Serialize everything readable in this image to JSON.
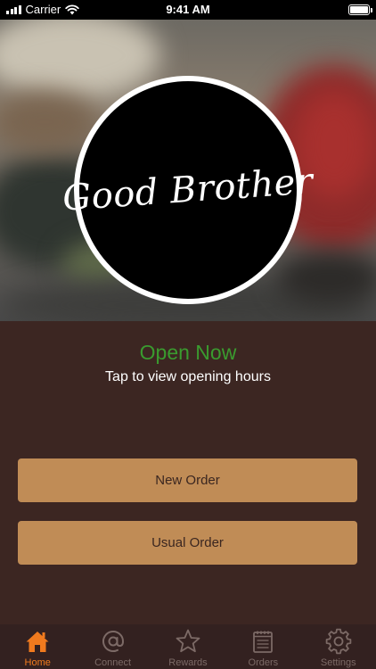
{
  "status_bar": {
    "carrier": "Carrier",
    "time": "9:41 AM"
  },
  "hero": {
    "logo_text": "Good Brother"
  },
  "status": {
    "open_text": "Open Now",
    "hours_hint": "Tap to view opening hours"
  },
  "actions": {
    "new_order": "New Order",
    "usual_order": "Usual Order"
  },
  "tabs": [
    {
      "label": "Home",
      "icon": "home-icon",
      "active": true
    },
    {
      "label": "Connect",
      "icon": "at-icon",
      "active": false
    },
    {
      "label": "Rewards",
      "icon": "star-icon",
      "active": false
    },
    {
      "label": "Orders",
      "icon": "notepad-icon",
      "active": false
    },
    {
      "label": "Settings",
      "icon": "gear-icon",
      "active": false
    }
  ],
  "colors": {
    "background": "#3c2622",
    "button": "#c08c56",
    "open_green": "#3a9b2f",
    "tab_active": "#f07a1e",
    "tab_inactive": "#7c6a66"
  }
}
